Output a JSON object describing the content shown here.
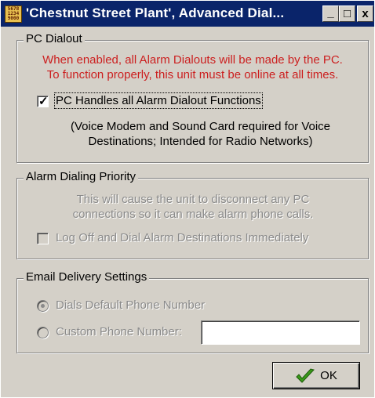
{
  "window": {
    "title": "'Chestnut Street Plant', Advanced Dial...",
    "app_icon_text": "5678\n1234\n9000",
    "controls": {
      "minimize": "_",
      "maximize": "□",
      "close": "x"
    }
  },
  "pc_dialout": {
    "legend": "PC Dialout",
    "warning_line1": "When enabled, all Alarm Dialouts will be made by the PC.",
    "warning_line2": "To function properly, this unit must be online at all times.",
    "checkbox_label": "PC Handles all Alarm Dialout Functions",
    "checkbox_checked": true,
    "note_line1": "(Voice Modem and Sound Card required for Voice",
    "note_line2": "Destinations; Intended for Radio Networks)"
  },
  "alarm_priority": {
    "legend": "Alarm Dialing Priority",
    "desc_line1": "This will cause the unit to disconnect any PC",
    "desc_line2": "connections so it can make alarm phone calls.",
    "checkbox_label": "Log Off and Dial Alarm Destinations Immediately",
    "checkbox_checked": false
  },
  "email": {
    "legend": "Email Delivery Settings",
    "radio_default_label": "Dials Default Phone Number",
    "radio_custom_label": "Custom Phone Number:",
    "selected": "default",
    "custom_number_value": ""
  },
  "ok_button": {
    "label": "OK",
    "icon": "checkmark-icon"
  },
  "colors": {
    "title_bar": "#0a246a",
    "face": "#d4d0c8",
    "warning_text": "#cc1f1f",
    "disabled_text": "#8a8a8a",
    "check_icon": "#3a9a1a"
  }
}
